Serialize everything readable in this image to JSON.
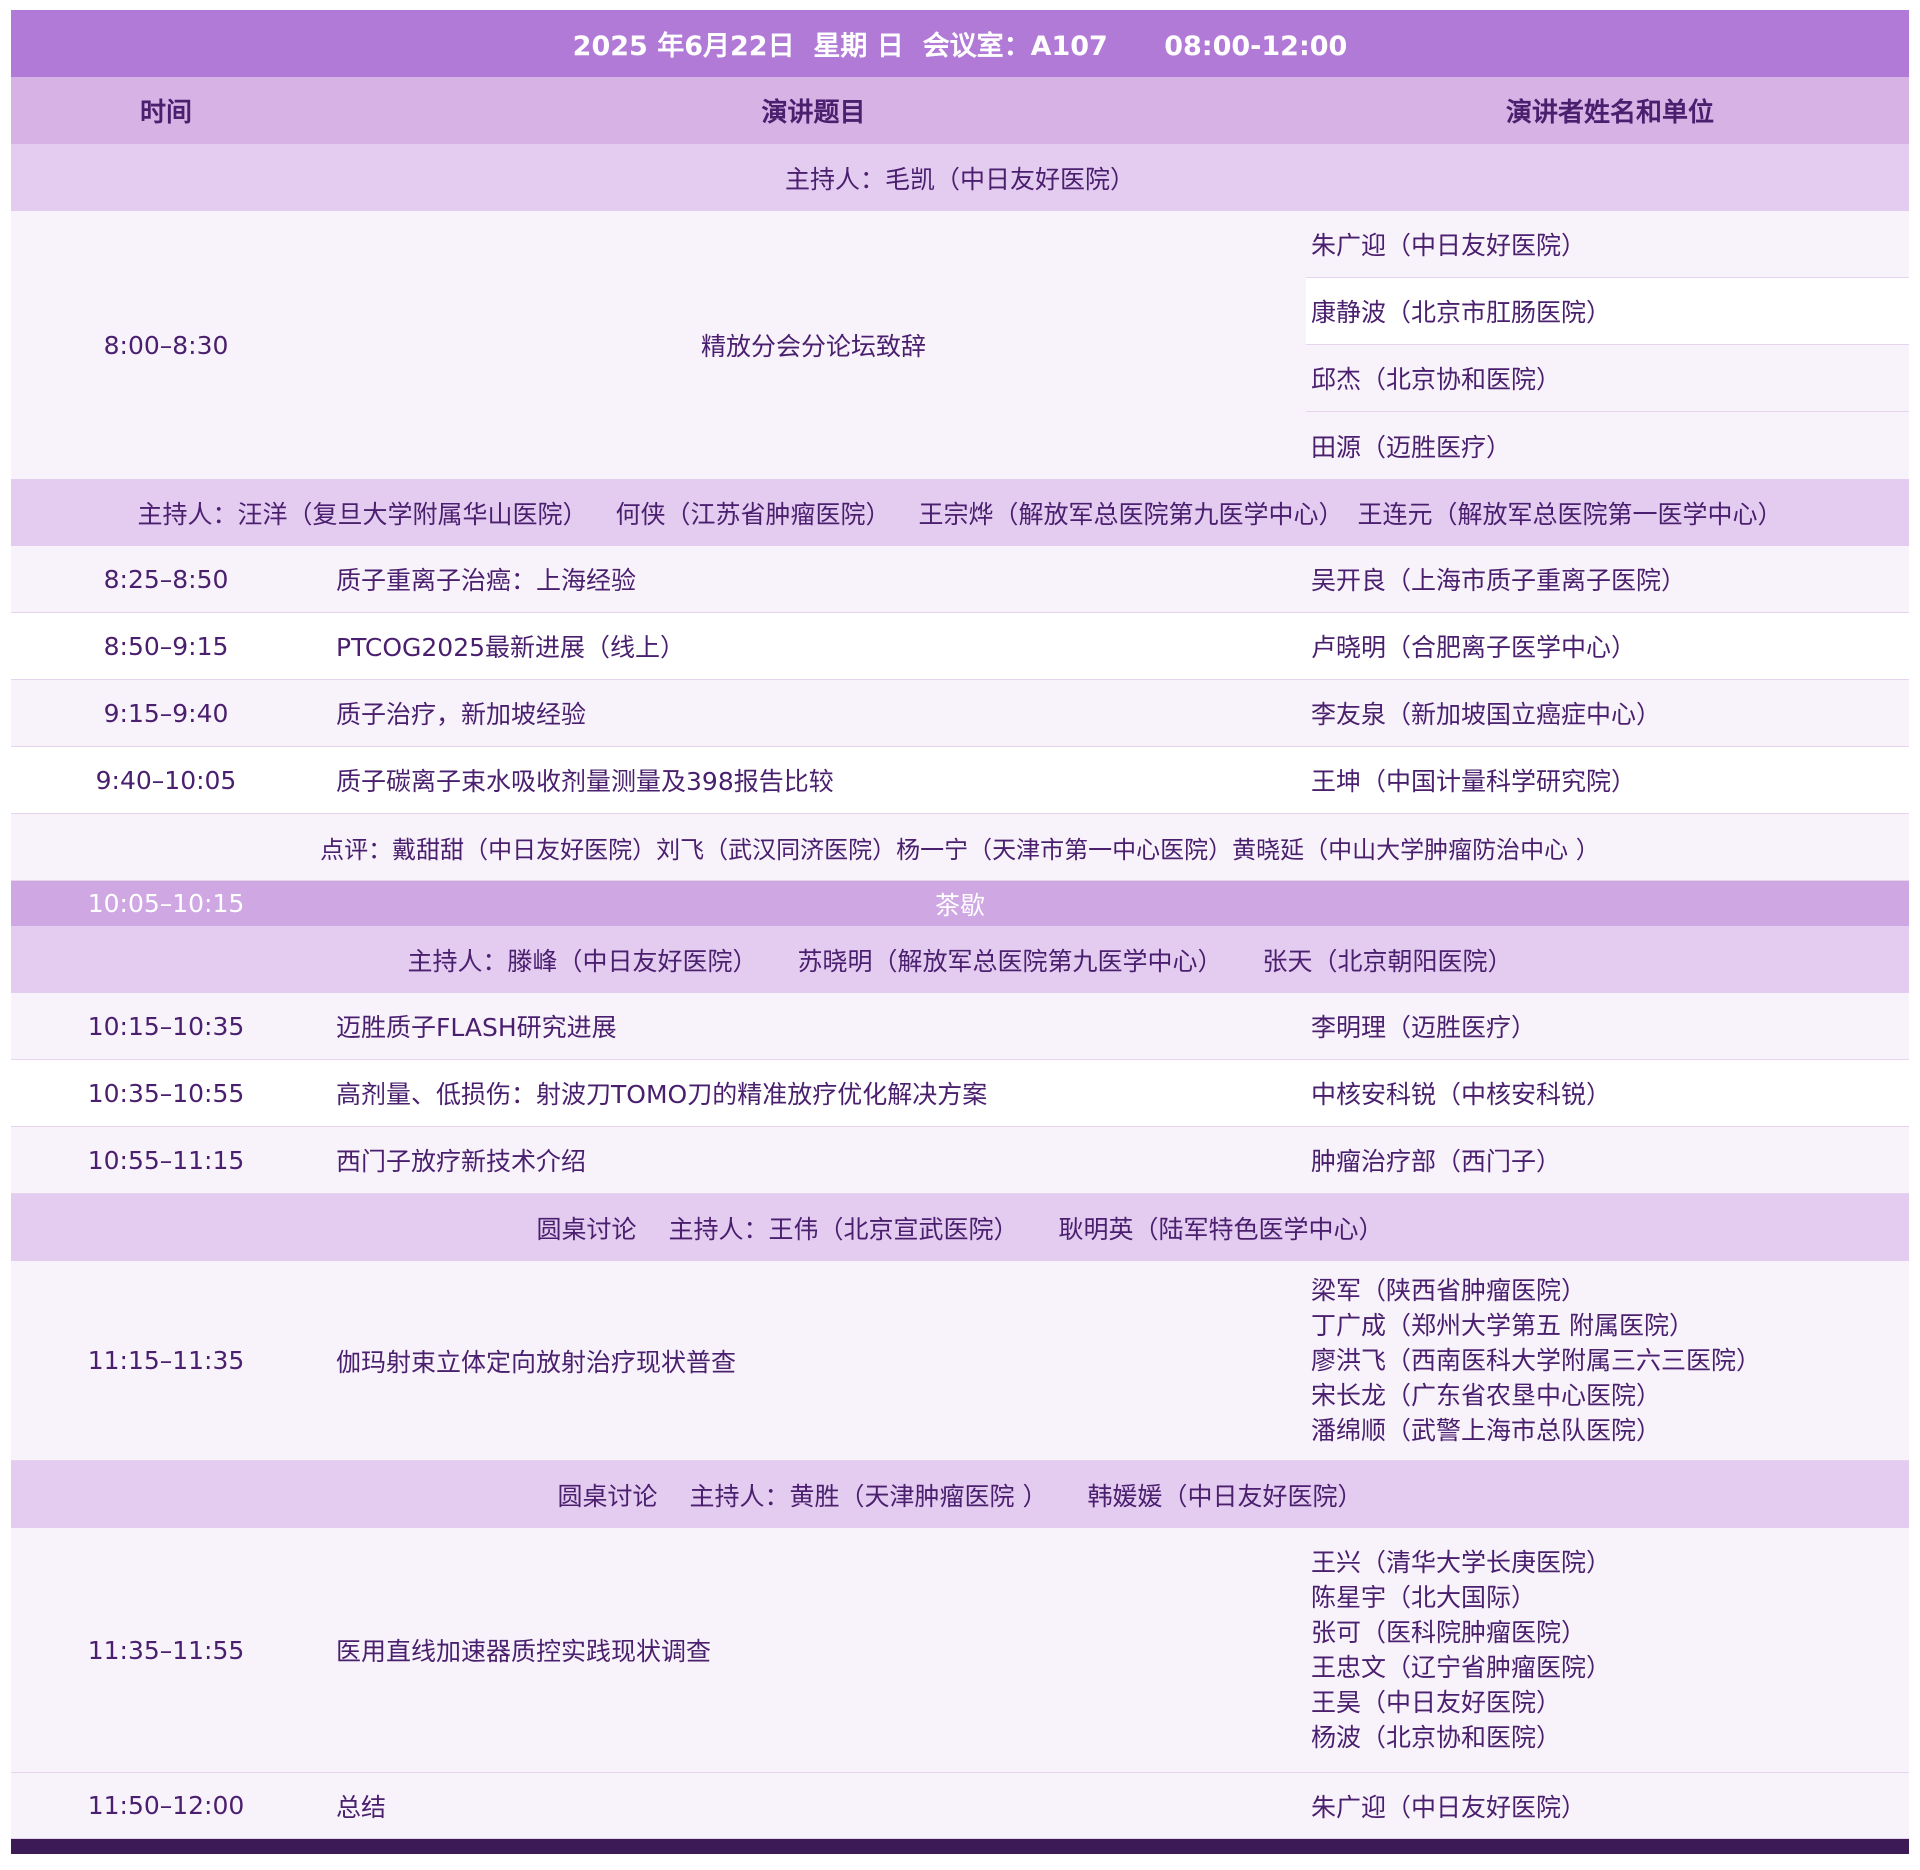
{
  "title": "2025 年6月22日  星期 日  会议室：A107      08:00-12:00",
  "headers": {
    "time": "时间",
    "topic": "演讲题目",
    "speaker": "演讲者姓名和单位"
  },
  "host1": "主持人：毛凯（中日友好医院）",
  "opening": {
    "time": "8:00–8:30",
    "topic": "精放分会分论坛致辞",
    "speakers": [
      "朱广迎（中日友好医院）",
      "康静波（北京市肛肠医院）",
      "邱杰（北京协和医院）",
      "田源（迈胜医疗）"
    ]
  },
  "host2": [
    "主持人：汪洋（复旦大学附属华山医院）",
    "何侠（江苏省肿瘤医院）",
    "王宗烨（解放军总医院第九医学中心）",
    "王连元（解放军总医院第一医学中心）"
  ],
  "session1": [
    {
      "time": "8:25–8:50",
      "topic": "质子重离子治癌：上海经验",
      "speaker": "吴开良（上海市质子重离子医院）"
    },
    {
      "time": "8:50–9:15",
      "topic": "PTCOG2025最新进展（线上）",
      "speaker": "卢晓明（合肥离子医学中心）"
    },
    {
      "time": "9:15–9:40",
      "topic": "质子治疗，新加坡经验",
      "speaker": "李友泉（新加坡国立癌症中心）"
    },
    {
      "time": "9:40–10:05",
      "topic": "质子碳离子束水吸收剂量测量及398报告比较",
      "speaker": "王坤（中国计量科学研究院）"
    }
  ],
  "comment": [
    "点评：戴甜甜（中日友好医院）",
    "刘飞（武汉同济医院）",
    "杨一宁（天津市第一中心医院）",
    "黄晓延（中山大学肿瘤防治中心 ）"
  ],
  "tea": {
    "time": "10:05–10:15",
    "label": "茶歇"
  },
  "host3": [
    "主持人：滕峰（中日友好医院）",
    "苏晓明（解放军总医院第九医学中心）",
    "张天（北京朝阳医院）"
  ],
  "session2": [
    {
      "time": "10:15–10:35",
      "topic": "迈胜质子FLASH研究进展",
      "speaker": "李明理（迈胜医疗）"
    },
    {
      "time": "10:35–10:55",
      "topic": "高剂量、低损伤：射波刀TOMO刀的精准放疗优化解决方案",
      "speaker": "中核安科锐（中核安科锐）"
    },
    {
      "time": "10:55–11:15",
      "topic": "西门子放疗新技术介绍",
      "speaker": "肿瘤治疗部（西门子）"
    }
  ],
  "round1_host": [
    "圆桌讨论",
    "主持人：王伟（北京宣武医院）",
    "耿明英（陆军特色医学中心）"
  ],
  "round1": {
    "time": "11:15–11:35",
    "topic": "伽玛射束立体定向放射治疗现状普查",
    "speakers": [
      "梁军（陕西省肿瘤医院）",
      "丁广成（郑州大学第五 附属医院）",
      "廖洪飞（西南医科大学附属三六三医院）",
      "宋长龙（广东省农垦中心医院）",
      "潘绵顺（武警上海市总队医院）"
    ]
  },
  "round2_host": [
    "圆桌讨论",
    "主持人：黄胜（天津肿瘤医院 ）",
    "韩媛媛（中日友好医院）"
  ],
  "round2": {
    "time": "11:35–11:55",
    "topic": "医用直线加速器质控实践现状调查",
    "speakers": [
      "王兴（清华大学长庚医院）",
      "陈星宇（北大国际）",
      "张可（医科院肿瘤医院）",
      "王忠文（辽宁省肿瘤医院）",
      "王昊（中日友好医院）",
      "杨波（北京协和医院）"
    ]
  },
  "summary": {
    "time": "11:50–12:00",
    "topic": "总结",
    "speaker": "朱广迎（中日友好医院）"
  }
}
